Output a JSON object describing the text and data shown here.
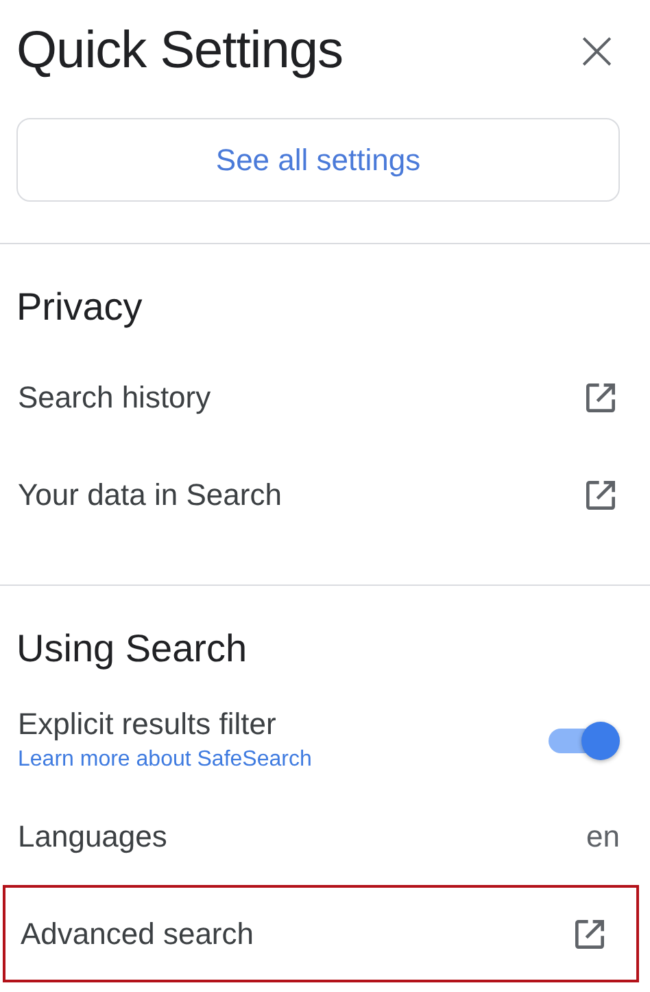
{
  "panel": {
    "title": "Quick Settings",
    "close": "×",
    "primary_button": "See all settings"
  },
  "sections": [
    {
      "heading": "Privacy",
      "items": [
        {
          "kind": "link",
          "label": "Search history",
          "highlighted": false
        },
        {
          "kind": "link",
          "label": "Your data in Search",
          "highlighted": false
        }
      ]
    },
    {
      "heading": "Using Search",
      "items": [
        {
          "kind": "toggle",
          "label": "Explicit results filter",
          "sublink": "Learn more about SafeSearch",
          "on": true,
          "highlighted": false
        },
        {
          "kind": "value",
          "label": "Languages",
          "value": "en",
          "highlighted": false
        },
        {
          "kind": "link",
          "label": "Advanced search",
          "highlighted": true
        }
      ]
    }
  ]
}
